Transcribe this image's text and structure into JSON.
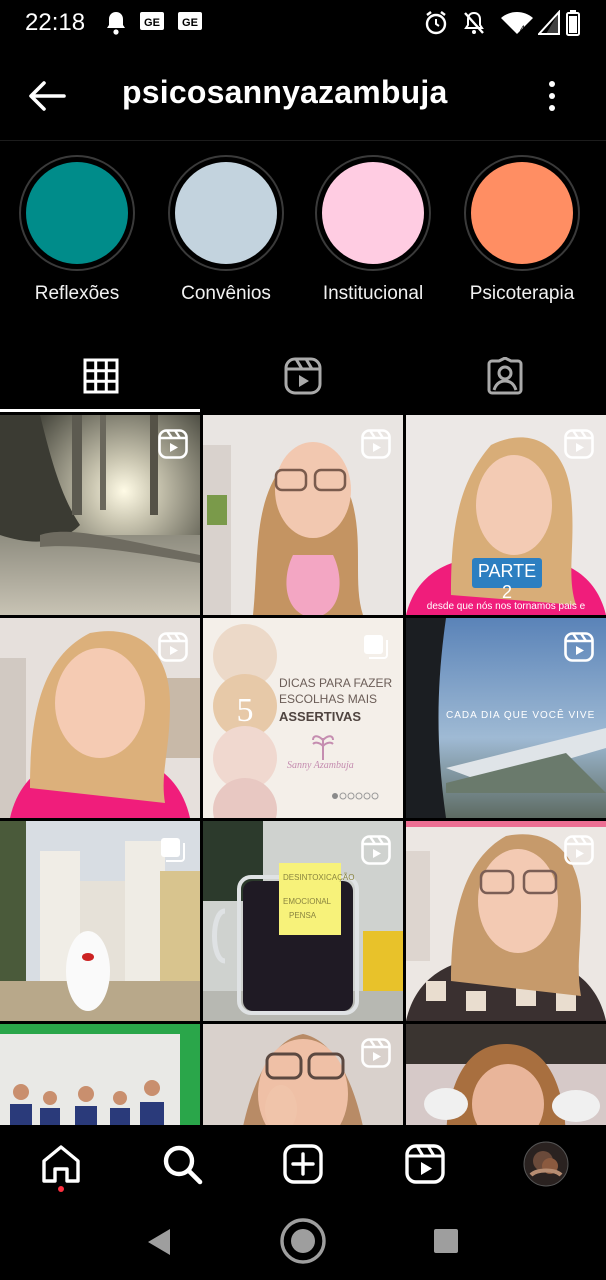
{
  "status_bar": {
    "time": "22:18",
    "left_icons": [
      "bell-icon",
      "ge-badge-icon",
      "ge-badge-icon"
    ],
    "right_icons": [
      "alarm-icon",
      "mute-icon",
      "wifi-icon",
      "signal-icon",
      "battery-icon"
    ],
    "badge_text": "GE"
  },
  "app_bar": {
    "title": "psicosannyazambuja",
    "back_icon": "back-arrow-icon",
    "menu_icon": "more-vert-icon"
  },
  "highlights": [
    {
      "label": "Reflexões",
      "color": "#008C8A"
    },
    {
      "label": "Convênios",
      "color": "#C3D3DE"
    },
    {
      "label": "Institucional",
      "color": "#FFCCE2"
    },
    {
      "label": "Psicoterapia",
      "color": "#FF8E63"
    }
  ],
  "tabs": [
    {
      "name": "posts-grid",
      "icon": "grid-icon",
      "active": true
    },
    {
      "name": "reels",
      "icon": "reels-icon",
      "active": false
    },
    {
      "name": "tagged",
      "icon": "tagged-person-icon",
      "active": false
    }
  ],
  "posts": {
    "p3_caption": "PARTE 2",
    "p3_subtitle": "desde que nós nos tornamos pais e",
    "p5_number": "5",
    "p5_line1": "DICAS PARA FAZER",
    "p5_line2": "ESCOLHAS MAIS",
    "p5_line3": "ASSERTIVAS",
    "p5_brand": "Sanny Azambuja",
    "p6_caption": "CADA DIA QUE VOCÊ VIVE",
    "p8_note_line1": "DESINTOXICAÇÃO",
    "p8_note_line2": "EMOCIONAL",
    "p8_note_line3": "PENSA",
    "colors": {
      "pink_shirt": "#F3A6C3",
      "magenta_shirt": "#F01D7B",
      "blue_caption": "#2C7FC1",
      "cream": "#F4EFE9",
      "tan_circle": "#E7C9A8"
    }
  },
  "bottom_nav": [
    "home-icon",
    "search-icon",
    "create-post-icon",
    "reels-icon",
    "profile-avatar-icon"
  ],
  "system_nav": [
    "nav-back-icon",
    "nav-home-icon",
    "nav-recents-icon"
  ]
}
